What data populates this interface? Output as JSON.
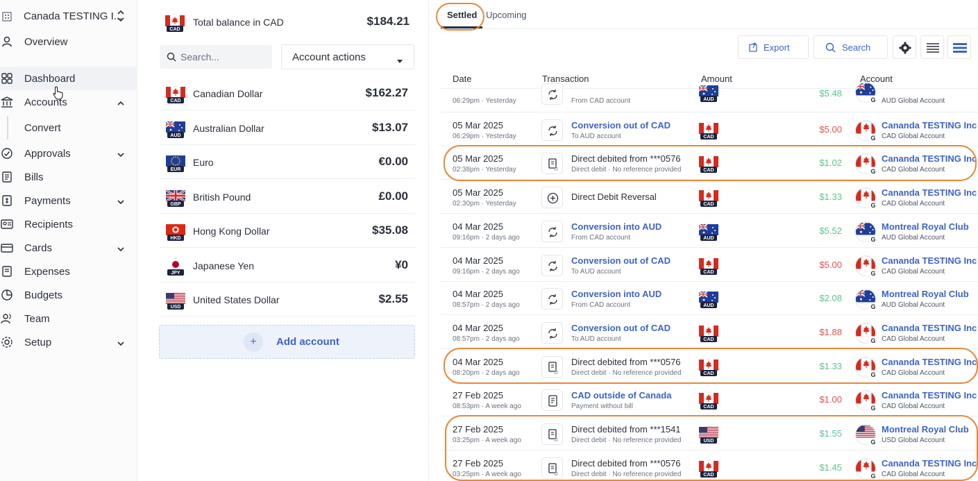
{
  "sidebar": {
    "org_name": "Canada TESTING I...",
    "items": [
      {
        "label": "Overview"
      },
      {
        "label": "Dashboard"
      },
      {
        "label": "Accounts"
      },
      {
        "label": "Convert"
      },
      {
        "label": "Approvals"
      },
      {
        "label": "Bills"
      },
      {
        "label": "Payments"
      },
      {
        "label": "Recipients"
      },
      {
        "label": "Cards"
      },
      {
        "label": "Expenses"
      },
      {
        "label": "Budgets"
      },
      {
        "label": "Team"
      },
      {
        "label": "Setup"
      }
    ]
  },
  "balances": {
    "total_label": "Total balance in CAD",
    "total_value": "$184.21",
    "total_code": "CAD",
    "search_placeholder": "Search...",
    "actions_label": "Account actions",
    "accounts": [
      {
        "code": "CAD",
        "name": "Canadian Dollar",
        "value": "$162.27"
      },
      {
        "code": "AUD",
        "name": "Australian Dollar",
        "value": "$13.07"
      },
      {
        "code": "EUR",
        "name": "Euro",
        "value": "€0.00"
      },
      {
        "code": "GBP",
        "name": "British Pound",
        "value": "£0.00"
      },
      {
        "code": "HKD",
        "name": "Hong Kong Dollar",
        "value": "$35.08"
      },
      {
        "code": "JPY",
        "name": "Japanese Yen",
        "value": "¥0"
      },
      {
        "code": "USD",
        "name": "United States Dollar",
        "value": "$2.55"
      }
    ],
    "add_label": "Add account",
    "add_plus": "+"
  },
  "transactions": {
    "tabs": [
      {
        "label": "Settled"
      },
      {
        "label": "Upcoming"
      }
    ],
    "export_label": "Export",
    "search_label": "Search",
    "columns": [
      "Date",
      "Transaction",
      "Amount",
      "Account"
    ],
    "accent_color": "#3d63c8",
    "highlight_color": "#e8883a",
    "rows": [
      {
        "date": "",
        "time": "06:29pm · Yesterday",
        "icon": "conversion-icon",
        "title": "",
        "sub": "From CAD account",
        "link": true,
        "code": "AUD",
        "amount": "$5.48",
        "kind": "in",
        "account": "",
        "account_sub": "AUD Global Account",
        "account_code": "AUD"
      },
      {
        "date": "05 Mar 2025",
        "time": "06:29pm · Yesterday",
        "icon": "conversion-icon",
        "title": "Conversion out of CAD",
        "sub": "To AUD account",
        "link": true,
        "code": "CAD",
        "amount": "$5.00",
        "kind": "out",
        "account": "Cananda TESTING Inc",
        "account_sub": "CAD Global Account",
        "account_code": "CAD"
      },
      {
        "date": "05 Mar 2025",
        "time": "02:38pm · Yesterday",
        "icon": "direct-debit-icon",
        "title": "Direct debited from ***0576",
        "sub": "Direct debit · No reference provided",
        "link": false,
        "code": "CAD",
        "amount": "$1.02",
        "kind": "in",
        "account": "Cananda TESTING Inc",
        "account_sub": "CAD Global Account",
        "account_code": "CAD"
      },
      {
        "date": "05 Mar 2025",
        "time": "02:30pm · Yesterday",
        "icon": "plus-circle-icon",
        "title": "Direct Debit Reversal",
        "sub": "",
        "link": false,
        "code": "CAD",
        "amount": "$1.33",
        "kind": "in",
        "account": "Cananda TESTING Inc",
        "account_sub": "CAD Global Account",
        "account_code": "CAD"
      },
      {
        "date": "04 Mar 2025",
        "time": "09:16pm · 2 days ago",
        "icon": "conversion-icon",
        "title": "Conversion into AUD",
        "sub": "From CAD account",
        "link": true,
        "code": "AUD",
        "amount": "$5.52",
        "kind": "in",
        "account": "Montreal Royal Club",
        "account_sub": "AUD Global Account",
        "account_code": "AUD"
      },
      {
        "date": "04 Mar 2025",
        "time": "09:16pm · 2 days ago",
        "icon": "conversion-icon",
        "title": "Conversion out of CAD",
        "sub": "To AUD account",
        "link": true,
        "code": "CAD",
        "amount": "$5.00",
        "kind": "out",
        "account": "Cananda TESTING Inc",
        "account_sub": "CAD Global Account",
        "account_code": "CAD"
      },
      {
        "date": "04 Mar 2025",
        "time": "08:57pm · 2 days ago",
        "icon": "conversion-icon",
        "title": "Conversion into AUD",
        "sub": "From CAD account",
        "link": true,
        "code": "AUD",
        "amount": "$2.08",
        "kind": "in",
        "account": "Montreal Royal Club",
        "account_sub": "AUD Global Account",
        "account_code": "AUD"
      },
      {
        "date": "04 Mar 2025",
        "time": "08:57pm · 2 days ago",
        "icon": "conversion-icon",
        "title": "Conversion out of CAD",
        "sub": "To AUD account",
        "link": true,
        "code": "CAD",
        "amount": "$1.88",
        "kind": "out",
        "account": "Cananda TESTING Inc",
        "account_sub": "CAD Global Account",
        "account_code": "CAD"
      },
      {
        "date": "04 Mar 2025",
        "time": "08:20pm · 2 days ago",
        "icon": "direct-debit-icon",
        "title": "Direct debited from ***0576",
        "sub": "Direct debit · No reference provided",
        "link": false,
        "code": "CAD",
        "amount": "$1.33",
        "kind": "in",
        "account": "Cananda TESTING Inc",
        "account_sub": "CAD Global Account",
        "account_code": "CAD"
      },
      {
        "date": "27 Feb 2025",
        "time": "08:53pm · A week ago",
        "icon": "bill-icon",
        "title": "CAD outside of Canada",
        "sub": "Payment without bill",
        "link": true,
        "code": "CAD",
        "amount": "$1.00",
        "kind": "out",
        "account": "Cananda TESTING Inc",
        "account_sub": "CAD Global Account",
        "account_code": "CAD"
      },
      {
        "date": "27 Feb 2025",
        "time": "03:25pm · A week ago",
        "icon": "direct-debit-icon",
        "title": "Direct debited from ***1541",
        "sub": "Direct debit · No reference provided",
        "link": false,
        "code": "USD",
        "amount": "$1.55",
        "kind": "in",
        "account": "Montreal Royal Club",
        "account_sub": "USD Global Account",
        "account_code": "USD"
      },
      {
        "date": "27 Feb 2025",
        "time": "03:25pm · A week ago",
        "icon": "direct-debit-icon",
        "title": "Direct debited from ***0576",
        "sub": "Direct debit · No reference provided",
        "link": false,
        "code": "CAD",
        "amount": "$1.45",
        "kind": "in",
        "account": "Cananda TESTING Inc",
        "account_sub": "CAD Global Account",
        "account_code": "CAD"
      }
    ]
  }
}
